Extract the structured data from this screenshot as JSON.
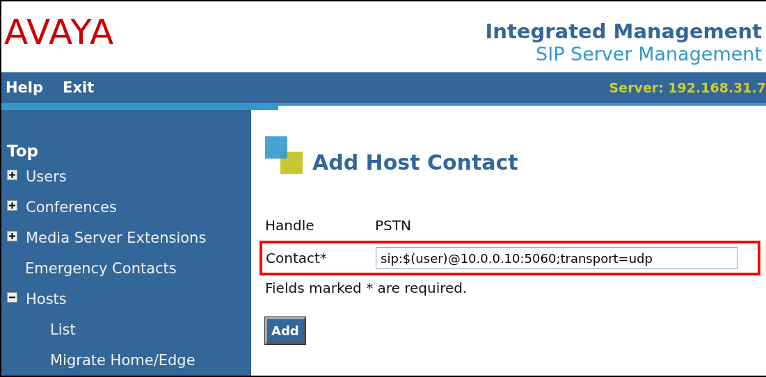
{
  "header": {
    "logo": "AVAYA",
    "title": "Integrated Management",
    "subtitle": "SIP Server Management"
  },
  "nav": {
    "links": [
      "Help",
      "Exit"
    ],
    "server": "Server: 192.168.31.7"
  },
  "sidebar": {
    "heading": "Top",
    "items": [
      {
        "label": "Users",
        "expanded": false
      },
      {
        "label": "Conferences",
        "expanded": false
      },
      {
        "label": "Media Server Extensions",
        "expanded": false
      },
      {
        "label": "Emergency Contacts"
      },
      {
        "label": "Hosts",
        "expanded": true,
        "children": [
          {
            "label": "List"
          },
          {
            "label": "Migrate Home/Edge"
          }
        ]
      }
    ]
  },
  "form": {
    "title": "Add Host Contact",
    "fields": [
      {
        "kind": "text",
        "label": "Handle",
        "value": "PSTN"
      },
      {
        "kind": "input",
        "label": "Contact*",
        "value": "sip:$(user)@10.0.0.10:5060;transport=udp",
        "highlighted": true
      }
    ],
    "note": "Fields marked * are required.",
    "button": "Add"
  }
}
